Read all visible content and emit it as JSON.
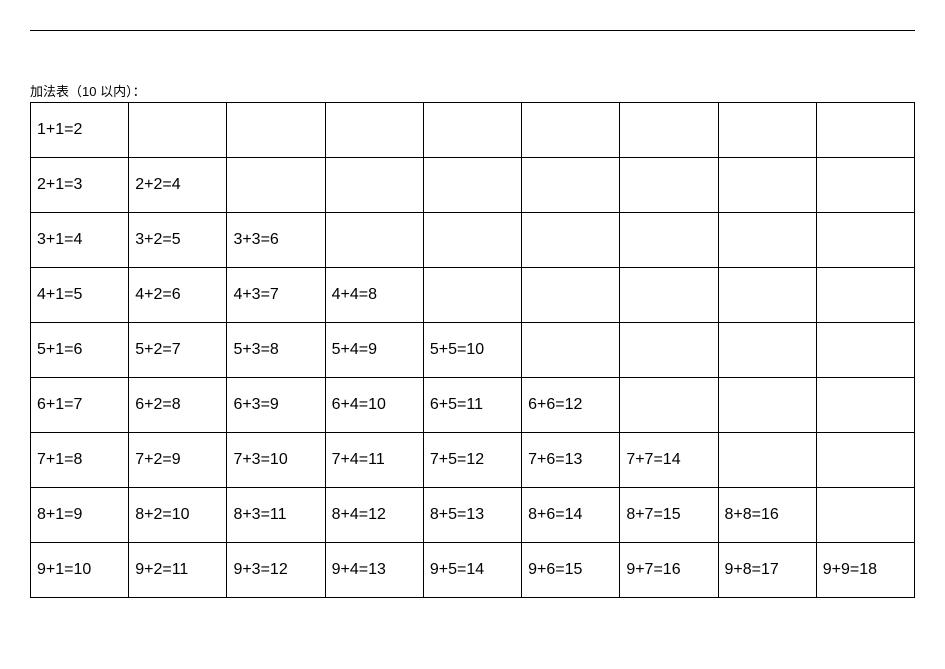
{
  "caption": "加法表（10 以内）：",
  "chart_data": {
    "type": "table",
    "title": "加法表（10 以内）",
    "rows": [
      [
        "1+1=2",
        "",
        "",
        "",
        "",
        "",
        "",
        "",
        ""
      ],
      [
        "2+1=3",
        "2+2=4",
        "",
        "",
        "",
        "",
        "",
        "",
        ""
      ],
      [
        "3+1=4",
        "3+2=5",
        "3+3=6",
        "",
        "",
        "",
        "",
        "",
        ""
      ],
      [
        "4+1=5",
        "4+2=6",
        "4+3=7",
        "4+4=8",
        "",
        "",
        "",
        "",
        ""
      ],
      [
        "5+1=6",
        "5+2=7",
        "5+3=8",
        "5+4=9",
        "5+5=10",
        "",
        "",
        "",
        ""
      ],
      [
        "6+1=7",
        "6+2=8",
        "6+3=9",
        "6+4=10",
        "6+5=11",
        "6+6=12",
        "",
        "",
        ""
      ],
      [
        "7+1=8",
        "7+2=9",
        "7+3=10",
        "7+4=11",
        "7+5=12",
        "7+6=13",
        "7+7=14",
        "",
        ""
      ],
      [
        "8+1=9",
        "8+2=10",
        "8+3=11",
        "8+4=12",
        "8+5=13",
        "8+6=14",
        "8+7=15",
        "8+8=16",
        ""
      ],
      [
        "9+1=10",
        "9+2=11",
        "9+3=12",
        "9+4=13",
        "9+5=14",
        "9+6=15",
        "9+7=16",
        "9+8=17",
        "9+9=18"
      ]
    ]
  }
}
